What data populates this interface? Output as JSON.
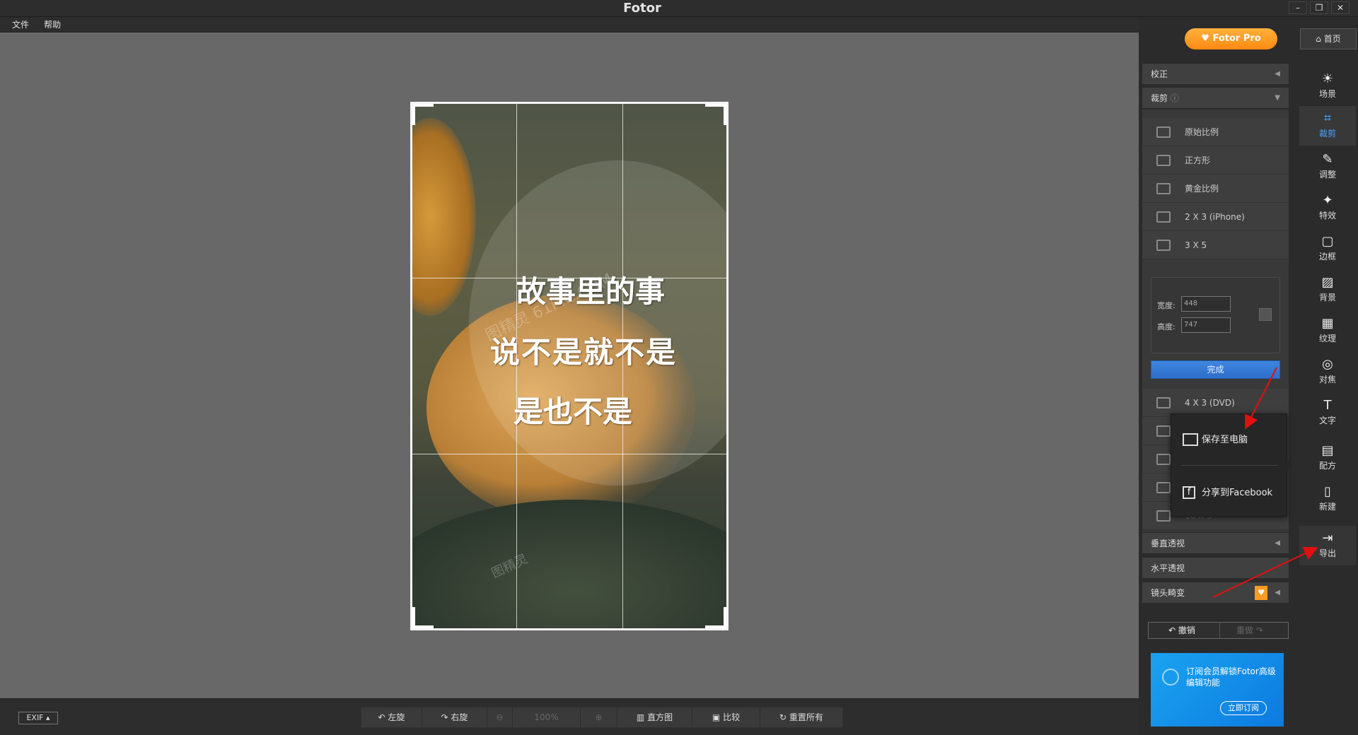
{
  "window": {
    "title": "Fotor",
    "minimize": "–",
    "restore": "❐",
    "close": "✕"
  },
  "menu": {
    "file": "文件",
    "help": "帮助"
  },
  "photo": {
    "lines": [
      "故事里的事",
      "说不是就不是",
      "是也不是"
    ],
    "watermark": "图精灵 61PIC.COM",
    "watermark2": "图精灵"
  },
  "bottom": {
    "exif": "EXIF ▴",
    "rotate_left": "左旋",
    "rotate_right": "右旋",
    "zoom": "100%",
    "histogram": "直方图",
    "compare": "比较",
    "reset_all": "重置所有"
  },
  "header": {
    "pro": "♥ Fotor Pro",
    "home": "首页"
  },
  "panel": {
    "correction": "校正",
    "crop": "裁剪",
    "crop_help": "ⓘ",
    "options": [
      "原始比例",
      "正方形",
      "黄金比例",
      "2 X 3 (iPhone)",
      "3 X 5",
      "4 X 3 (DVD)"
    ],
    "hidden_options": [
      "",
      "",
      "",
      "16 X 9"
    ],
    "width_label": "宽度:",
    "width_value": "448",
    "height_label": "高度:",
    "height_value": "747",
    "done": "完成",
    "vertical_perspective": "垂直透视",
    "horizontal_perspective": "水平透视",
    "lens_distortion": "镜头畸变",
    "undo": "↶ 撤销",
    "redo": "重做 ↷"
  },
  "popup": {
    "save_pc": "保存至电脑",
    "share_fb": "分享到Facebook"
  },
  "ad": {
    "text": "订阅会员解锁Fotor高级编辑功能",
    "button": "立即订阅"
  },
  "sidebar": [
    {
      "icon": "☀",
      "label": "场景"
    },
    {
      "icon": "⌗",
      "label": "裁剪"
    },
    {
      "icon": "✎",
      "label": "调整"
    },
    {
      "icon": "✦",
      "label": "特效"
    },
    {
      "icon": "▢",
      "label": "边框"
    },
    {
      "icon": "▨",
      "label": "背景"
    },
    {
      "icon": "▦",
      "label": "纹理"
    },
    {
      "icon": "◎",
      "label": "对焦"
    },
    {
      "icon": "T",
      "label": "文字"
    },
    {
      "icon": "▤",
      "label": "配方"
    },
    {
      "icon": "▯",
      "label": "新建"
    },
    {
      "icon": "⇥",
      "label": "导出"
    }
  ],
  "colors": {
    "accent_orange": "#ff9a22",
    "accent_blue": "#3f86e0",
    "arrow_red": "#e01010"
  }
}
